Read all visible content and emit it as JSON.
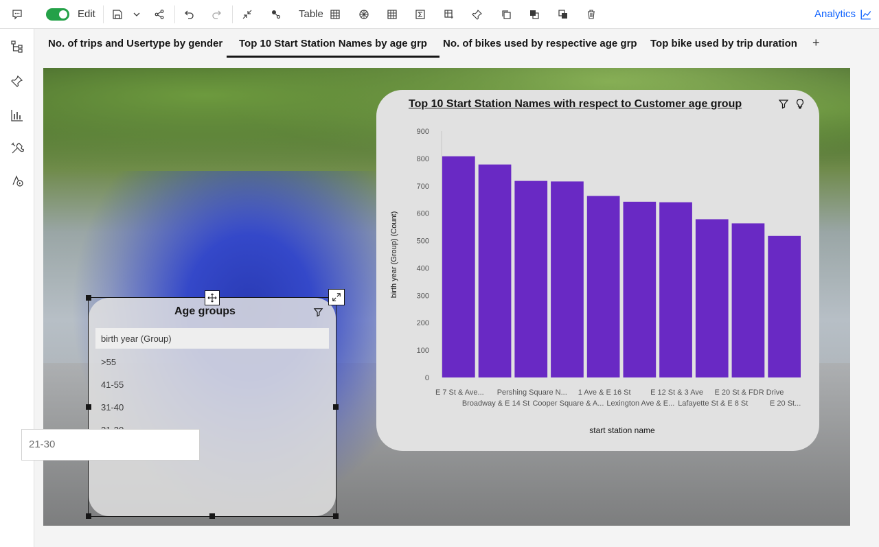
{
  "toolbar": {
    "edit_label": "Edit",
    "table_label": "Table",
    "analytics_label": "Analytics",
    "colors": {
      "toggle_on": "#24a148",
      "accent": "#0f62fe"
    }
  },
  "tabs": [
    {
      "label": "No. of trips and Usertype by gender"
    },
    {
      "label": "Top 10 Start Station Names by age grp",
      "active": true
    },
    {
      "label": "No. of bikes used by respective age grp"
    },
    {
      "label": "Top bike used by trip duration"
    }
  ],
  "tab_add": "+",
  "age_card": {
    "title": "Age groups",
    "header": "birth year (Group)",
    "items": [
      ">55",
      "41-55",
      "31-40",
      "21-30"
    ]
  },
  "dropdown": {
    "value": "21-30"
  },
  "chart_data": {
    "type": "bar",
    "title": "Top 10 Start Station Names with respect to Customer age group",
    "xlabel": "start station name",
    "ylabel": "birth year (Group) (Count)",
    "ylim": [
      0,
      900
    ],
    "yticks": [
      0,
      100,
      200,
      300,
      400,
      500,
      600,
      700,
      800,
      900
    ],
    "categories": [
      "E 7 St & Ave...",
      "Broadway & E 14 St",
      "Pershing Square N...",
      "Cooper Square & A...",
      "1 Ave & E 16 St",
      "Lexington Ave & E...",
      "E 12 St & 3 Ave",
      "Lafayette St & E 8 St",
      "E 20 St & FDR Drive",
      "E 20 St..."
    ],
    "values": [
      808,
      778,
      718,
      716,
      663,
      642,
      640,
      578,
      563,
      517
    ],
    "bar_color": "#6929c4",
    "grid": false
  }
}
